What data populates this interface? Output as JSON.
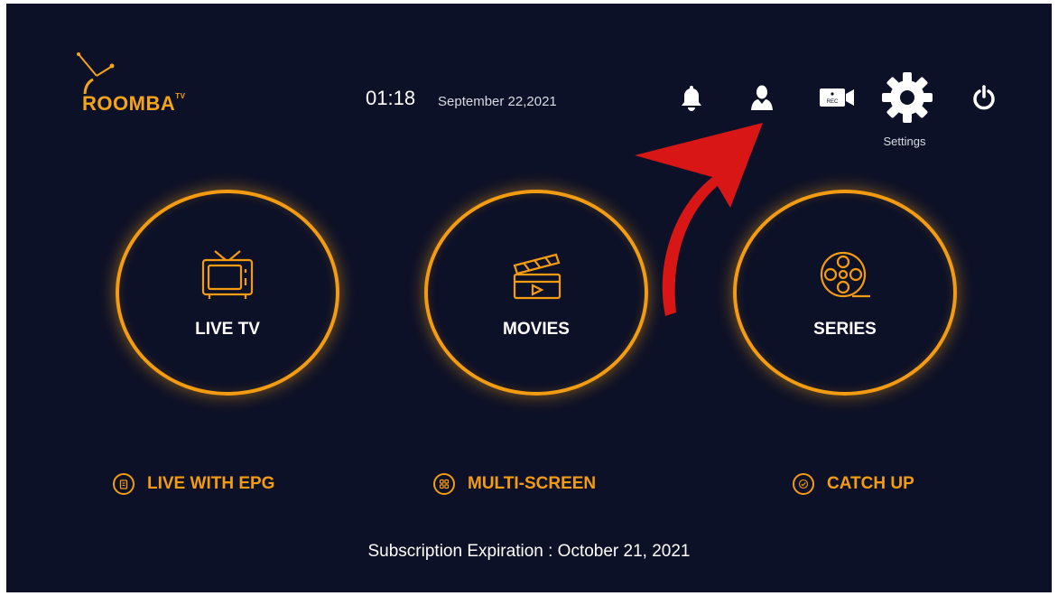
{
  "brand": {
    "name": "ROOMBA",
    "superscript": "TV",
    "color": "#f4a31a"
  },
  "header": {
    "time": "01:18",
    "date": "September 22,2021",
    "icons": [
      "bell-icon",
      "user-icon",
      "rec-icon",
      "gear-icon",
      "power-icon"
    ],
    "rec_text": "REC",
    "settings_label": "Settings"
  },
  "tiles": [
    {
      "label": "LIVE TV",
      "icon": "tv-icon"
    },
    {
      "label": "MOVIES",
      "icon": "clapperboard-icon"
    },
    {
      "label": "SERIES",
      "icon": "film-reel-icon"
    }
  ],
  "links": [
    {
      "label": "LIVE WITH EPG",
      "icon": "clipboard-icon"
    },
    {
      "label": "MULTI-SCREEN",
      "icon": "grid-icon"
    },
    {
      "label": "CATCH UP",
      "icon": "check-icon"
    }
  ],
  "footer": {
    "subscription": "Subscription Expiration : October 21, 2021"
  },
  "colors": {
    "background": "#0d1127",
    "accent": "#f39c12",
    "arrow": "#d91616"
  }
}
